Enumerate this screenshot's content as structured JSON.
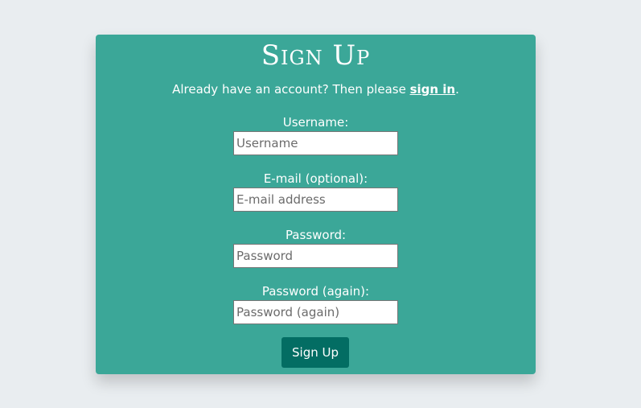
{
  "form": {
    "title": "Sign Up",
    "signin_prefix": "Already have an account? Then please ",
    "signin_link": "sign in",
    "signin_suffix": ".",
    "fields": [
      {
        "label": "Username:",
        "placeholder": "Username",
        "value": ""
      },
      {
        "label": "E-mail (optional):",
        "placeholder": "E-mail address",
        "value": ""
      },
      {
        "label": "Password:",
        "placeholder": "Password",
        "value": ""
      },
      {
        "label": "Password (again):",
        "placeholder": "Password (again)",
        "value": ""
      }
    ],
    "submit_label": "Sign Up"
  },
  "colors": {
    "page_background": "#e9edf0",
    "card_background": "#3ba798",
    "button_background": "#036d63",
    "text": "#ffffff"
  }
}
